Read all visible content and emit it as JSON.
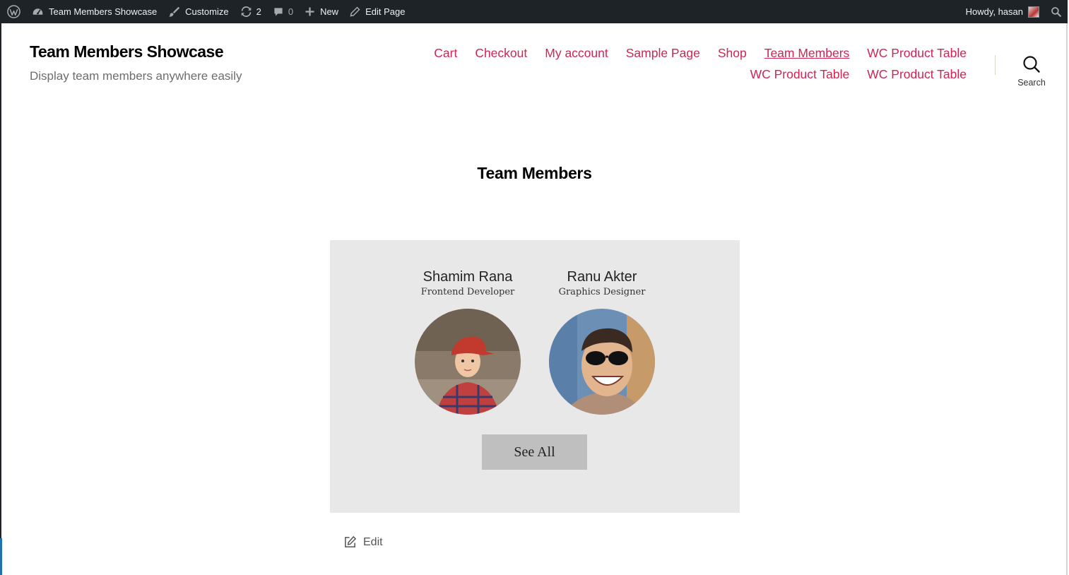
{
  "admin_bar": {
    "site_name": "Team Members Showcase",
    "customize": "Customize",
    "updates_count": "2",
    "comments_count": "0",
    "new": "New",
    "edit_page": "Edit Page",
    "howdy": "Howdy, hasan"
  },
  "header": {
    "site_title": "Team Members Showcase",
    "site_description": "Display team members anywhere easily",
    "search_label": "Search"
  },
  "nav": {
    "items": [
      {
        "label": "Cart"
      },
      {
        "label": "Checkout"
      },
      {
        "label": "My account"
      },
      {
        "label": "Sample Page"
      },
      {
        "label": "Shop"
      },
      {
        "label": "Team Members",
        "current": true
      },
      {
        "label": "WC Product Table"
      },
      {
        "label": "WC Product Table"
      },
      {
        "label": "WC Product Table"
      }
    ]
  },
  "main": {
    "page_title": "Team Members",
    "members": [
      {
        "name": "Shamim Rana",
        "role": "Frontend Developer"
      },
      {
        "name": "Ranu Akter",
        "role": "Graphics Designer"
      }
    ],
    "see_all": "See All",
    "edit": "Edit"
  },
  "colors": {
    "admin_bar_bg": "#1d2327",
    "link_accent": "#cd2653",
    "card_bg": "#e8e8e8",
    "button_bg": "#bfbfbf"
  }
}
